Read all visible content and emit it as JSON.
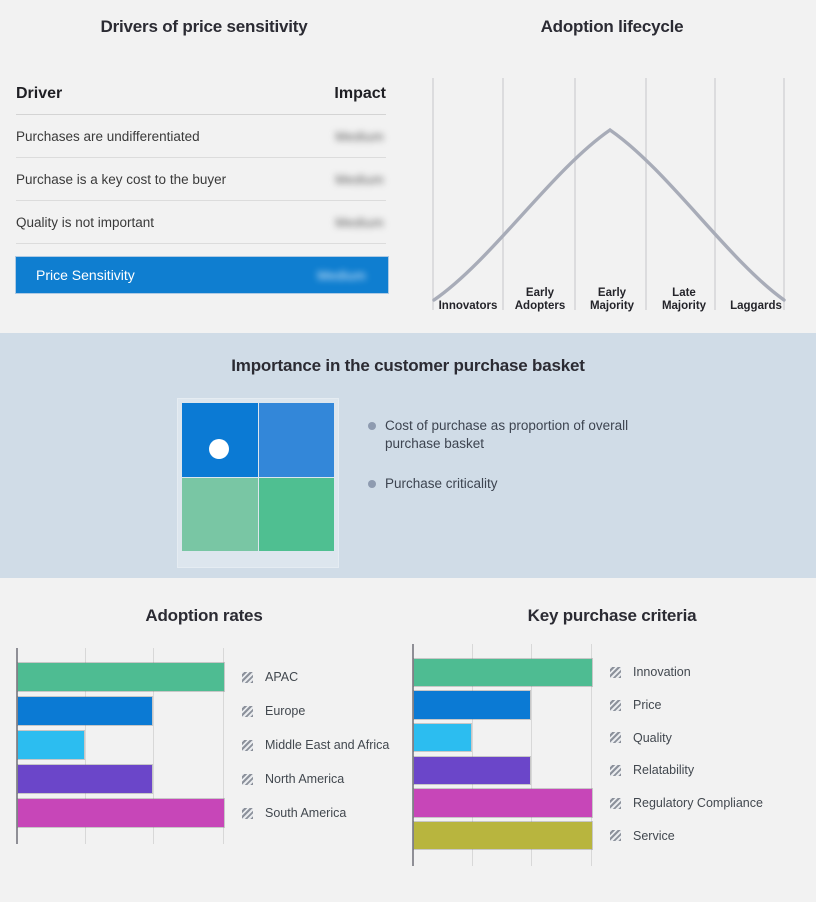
{
  "bands": {
    "top_bg": "#f2f2f2",
    "mid_bg": "#d0dce7",
    "bottom_bg": "#f2f2f2"
  },
  "drivers": {
    "title": "Drivers of price sensitivity",
    "columns": {
      "driver": "Driver",
      "impact": "Impact"
    },
    "rows": [
      {
        "driver": "Purchases are undifferentiated",
        "impact": "Medium"
      },
      {
        "driver": "Purchase is a key cost to the buyer",
        "impact": "Medium"
      },
      {
        "driver": "Quality is not important",
        "impact": "Medium"
      }
    ],
    "total": {
      "label": "Price Sensitivity",
      "impact": "Medium",
      "color": "#0f7ed0"
    }
  },
  "lifecycle": {
    "title": "Adoption lifecycle",
    "curve_color": "#a8acb8",
    "stages": [
      {
        "label_line1": "Innovators",
        "label_line2": ""
      },
      {
        "label_line1": "Early",
        "label_line2": "Adopters"
      },
      {
        "label_line1": "Early",
        "label_line2": "Majority"
      },
      {
        "label_line1": "Late",
        "label_line2": "Majority"
      },
      {
        "label_line1": "Laggards",
        "label_line2": ""
      }
    ],
    "chart_data": {
      "type": "line",
      "title": "Adoption lifecycle",
      "xlabel": "",
      "ylabel": "",
      "grid": true,
      "categories": [
        "Innovators",
        "Early Adopters",
        "Early Majority",
        "Late Majority",
        "Laggards"
      ],
      "x": [
        0,
        10,
        20,
        30,
        40,
        50,
        60,
        70,
        80,
        90,
        100
      ],
      "values": [
        2,
        14,
        30,
        50,
        72,
        88,
        95,
        90,
        72,
        44,
        8
      ],
      "series": [
        {
          "name": "Adoption",
          "values": [
            2,
            14,
            30,
            50,
            72,
            88,
            95,
            90,
            72,
            44,
            8
          ]
        }
      ],
      "xlim": [
        0,
        100
      ],
      "ylim": [
        0,
        100
      ],
      "legend_position": "none",
      "annotations": [
        "Bell curve peaking in the Early Majority stage"
      ]
    }
  },
  "basket": {
    "title": "Importance in the customer purchase basket",
    "quadrant_colors": {
      "top_left": "#0b7ad4",
      "top_right": "#3387d9",
      "bottom_left": "#79c6a4",
      "bottom_right": "#4fbf91"
    },
    "marker_color": "#ffffff",
    "bullet_color": "#8e9bb0",
    "legend": [
      "Cost of purchase as proportion of overall purchase basket",
      "Purchase criticality"
    ],
    "chart_data": {
      "type": "heatmap",
      "title": "Importance in the customer purchase basket",
      "xlabel": "Cost of purchase as proportion of overall purchase basket",
      "ylabel": "Purchase criticality",
      "grid": false,
      "legend_position": "right",
      "categories": [
        "low",
        "high"
      ],
      "values": [
        [
          1,
          1
        ],
        [
          0,
          0
        ]
      ],
      "marker": {
        "x": "low",
        "y": "high",
        "label": ""
      },
      "annotations": [
        "White marker positioned in the upper-left quadrant"
      ]
    }
  },
  "adoption_rates": {
    "title": "Adoption rates",
    "chart_data": {
      "type": "bar",
      "title": "Adoption rates",
      "orientation": "horizontal",
      "xlabel": "",
      "ylabel": "",
      "grid": true,
      "legend_position": "right",
      "categories": [
        "APAC",
        "Europe",
        "Middle East and Africa",
        "North America",
        "South America"
      ],
      "values": [
        100,
        65,
        32,
        65,
        100
      ],
      "colors": [
        "#4ebc92",
        "#0b7ad4",
        "#2cbdf0",
        "#6b46c9",
        "#c746b8"
      ],
      "xlim": [
        0,
        100
      ],
      "gridlines": [
        0,
        33,
        66,
        100
      ]
    }
  },
  "key_criteria": {
    "title": "Key purchase criteria",
    "chart_data": {
      "type": "bar",
      "title": "Key purchase criteria",
      "orientation": "horizontal",
      "xlabel": "",
      "ylabel": "",
      "grid": true,
      "legend_position": "right",
      "categories": [
        "Innovation",
        "Price",
        "Quality",
        "Relatability",
        "Regulatory Compliance",
        "Service"
      ],
      "values": [
        100,
        65,
        32,
        65,
        100,
        100
      ],
      "colors": [
        "#4ebc92",
        "#0b7ad4",
        "#2cbdf0",
        "#6b46c9",
        "#c746b8",
        "#b8b53e"
      ],
      "xlim": [
        0,
        100
      ],
      "gridlines": [
        0,
        33,
        66,
        100
      ]
    }
  }
}
